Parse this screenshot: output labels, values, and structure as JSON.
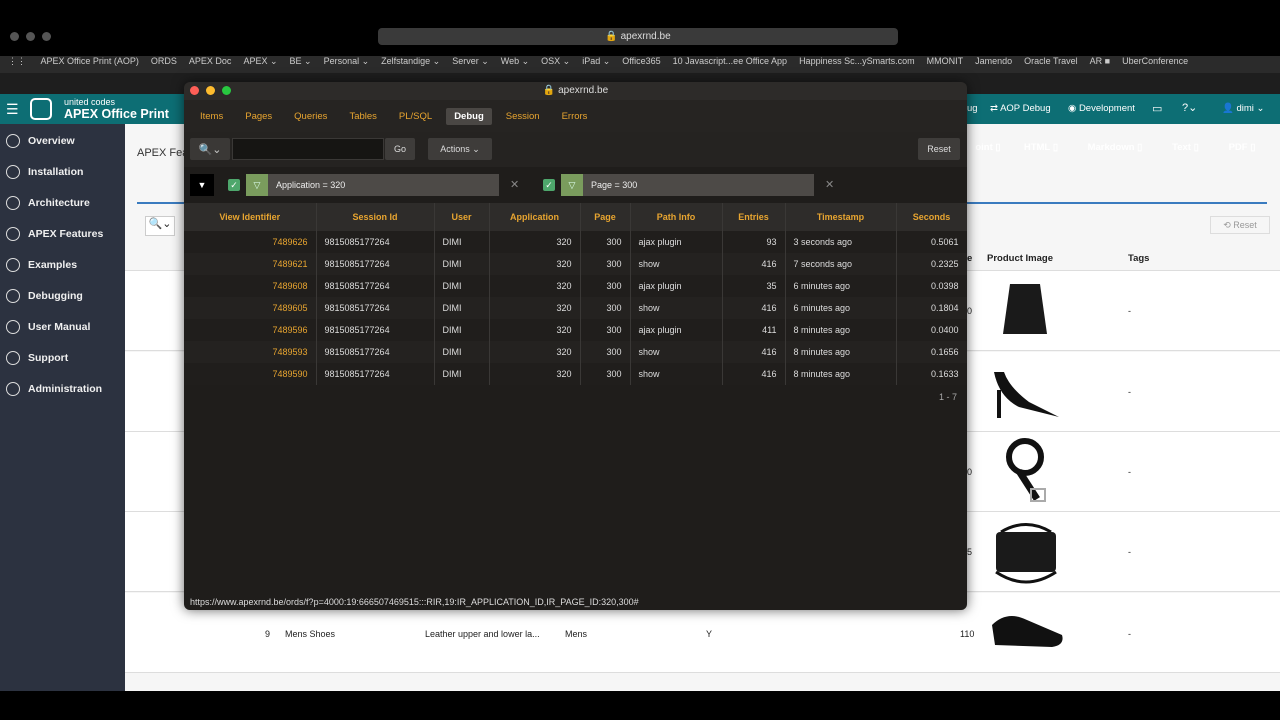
{
  "browser": {
    "url": "apexrnd.be",
    "favorites": [
      "APEX Office Print (AOP)",
      "ORDS",
      "APEX Doc",
      "APEX ⌄",
      "BE ⌄",
      "Personal ⌄",
      "Zelfstandige ⌄",
      "Server ⌄",
      "Web ⌄",
      "OSX ⌄",
      "iPad ⌄",
      "Office365",
      "10 Javascript...ee Office App",
      "Happiness Sc...ySmarts.com",
      "MMONIT",
      "Jamendo",
      "Oracle Travel",
      "AR ■",
      "UberConference"
    ]
  },
  "app": {
    "brand_line1": "united codes",
    "brand_line2": "APEX Office Print",
    "header_right": [
      "ug",
      "AOP Debug",
      "Development",
      "dimi"
    ],
    "nav": [
      {
        "label": "Overview",
        "icon": "info-icon"
      },
      {
        "label": "Installation",
        "icon": "play-icon"
      },
      {
        "label": "Architecture",
        "icon": "compass-icon"
      },
      {
        "label": "APEX Features",
        "icon": "tools-icon"
      },
      {
        "label": "Examples",
        "icon": "pages-icon"
      },
      {
        "label": "Debugging",
        "icon": "table-icon"
      },
      {
        "label": "User Manual",
        "icon": "book-icon"
      },
      {
        "label": "Support",
        "icon": "headset-icon"
      },
      {
        "label": "Administration",
        "icon": "wrench-icon"
      }
    ],
    "page_title_partial": "APEX Fea",
    "export_buttons": [
      {
        "label": "oint",
        "color": "#e8452c"
      },
      {
        "label": "HTML",
        "color": "#e8452c"
      },
      {
        "label": "Markdown",
        "color": "#222222"
      },
      {
        "label": "Text",
        "color": "#8a9aab"
      },
      {
        "label": "PDF",
        "color": "#d2231c"
      }
    ],
    "reset_label": "Reset",
    "columns_visible": [
      "e",
      "Product Image",
      "Tags"
    ],
    "bg_rows": [
      {
        "num": "0",
        "tags": "-"
      },
      {
        "num": "",
        "tags": "-"
      },
      {
        "num": "0",
        "tags": "-"
      },
      {
        "num": "5",
        "tags": "-"
      },
      {
        "id": "9",
        "name": "Mens Shoes",
        "desc": "Leather upper and lower la...",
        "cat": "Mens",
        "flag": "Y",
        "num": "110",
        "tags": "-"
      }
    ]
  },
  "debug_window": {
    "title": "apexrnd.be",
    "tabs": [
      "Items",
      "Pages",
      "Queries",
      "Tables",
      "PL/SQL",
      "Debug",
      "Session",
      "Errors"
    ],
    "active_tab": "Debug",
    "go_label": "Go",
    "actions_label": "Actions",
    "reset_label": "Reset",
    "filters": [
      "Application = 320",
      "Page = 300"
    ],
    "columns": [
      "View Identifier",
      "Session Id",
      "User",
      "Application",
      "Page",
      "Path Info",
      "Entries",
      "Timestamp",
      "Seconds"
    ],
    "rows": [
      [
        "7489626",
        "9815085177264",
        "DIMI",
        "320",
        "300",
        "ajax plugin",
        "93",
        "3 seconds ago",
        "0.5061"
      ],
      [
        "7489621",
        "9815085177264",
        "DIMI",
        "320",
        "300",
        "show",
        "416",
        "7 seconds ago",
        "0.2325"
      ],
      [
        "7489608",
        "9815085177264",
        "DIMI",
        "320",
        "300",
        "ajax plugin",
        "35",
        "6 minutes ago",
        "0.0398"
      ],
      [
        "7489605",
        "9815085177264",
        "DIMI",
        "320",
        "300",
        "show",
        "416",
        "6 minutes ago",
        "0.1804"
      ],
      [
        "7489596",
        "9815085177264",
        "DIMI",
        "320",
        "300",
        "ajax plugin",
        "411",
        "8 minutes ago",
        "0.0400"
      ],
      [
        "7489593",
        "9815085177264",
        "DIMI",
        "320",
        "300",
        "show",
        "416",
        "8 minutes ago",
        "0.1656"
      ],
      [
        "7489590",
        "9815085177264",
        "DIMI",
        "320",
        "300",
        "show",
        "416",
        "8 minutes ago",
        "0.1633"
      ]
    ],
    "pagination": "1 - 7",
    "status_url": "https://www.apexrnd.be/ords/f?p=4000:19:666507469515:::RIR,19:IR_APPLICATION_ID,IR_PAGE_ID:320,300#"
  }
}
